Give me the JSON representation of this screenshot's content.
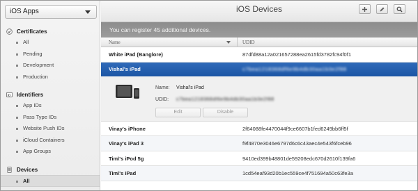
{
  "app_select": {
    "value": "iOS Apps"
  },
  "header": {
    "title": "iOS Devices"
  },
  "toolbar": {
    "add_icon": "plus-icon",
    "edit_icon": "pencil-icon",
    "search_icon": "search-icon"
  },
  "banner": {
    "text": "You can register 45 additional devices."
  },
  "sidebar": {
    "certificates": {
      "label": "Certificates",
      "items": [
        "All",
        "Pending",
        "Development",
        "Production"
      ]
    },
    "identifiers": {
      "label": "Identifiers",
      "items": [
        "App IDs",
        "Pass Type IDs",
        "Website Push IDs",
        "iCloud Containers",
        "App Groups"
      ]
    },
    "devices": {
      "label": "Devices",
      "items": [
        "All"
      ]
    }
  },
  "table": {
    "columns": [
      "Name",
      "UDID"
    ],
    "rows_top": [
      {
        "name": "White iPad (Banglore)",
        "udid": "87dfd88a12a021657288ea2615fd3782fc94f0f1"
      },
      {
        "name": "Vishal's iPad",
        "udid": "c7bea1218368df6e9b4db30aa1b3e2f88"
      }
    ],
    "rows_bottom": [
      {
        "name": "Vinay's iPhone",
        "udid": "2f64088fe4470044f9ce6607b1fed6249bb6ff5f"
      },
      {
        "name": "Vinay's iPad 3",
        "udid": "f9f4870e3046e6797d6c6c43aec4e543f6fceb96"
      },
      {
        "name": "Tim\\'s iPod 5g",
        "udid": "9410ed399b48801de59208edc670d2610f139fa6"
      },
      {
        "name": "Tim\\'s iPad",
        "udid": "1cd54eaf93d20b1ec559ce4f751694a50c63fe3a"
      }
    ]
  },
  "detail": {
    "name_label": "Name:",
    "name_value": "Vishal's iPad",
    "udid_label": "UDID:",
    "udid_value": "c7bea1218368df6e9b4db30aa1b3e2f88",
    "edit_label": "Edit",
    "disable_label": "Disable"
  },
  "colors": {
    "selected_row": "#2a64b4",
    "banner": "#939393"
  }
}
